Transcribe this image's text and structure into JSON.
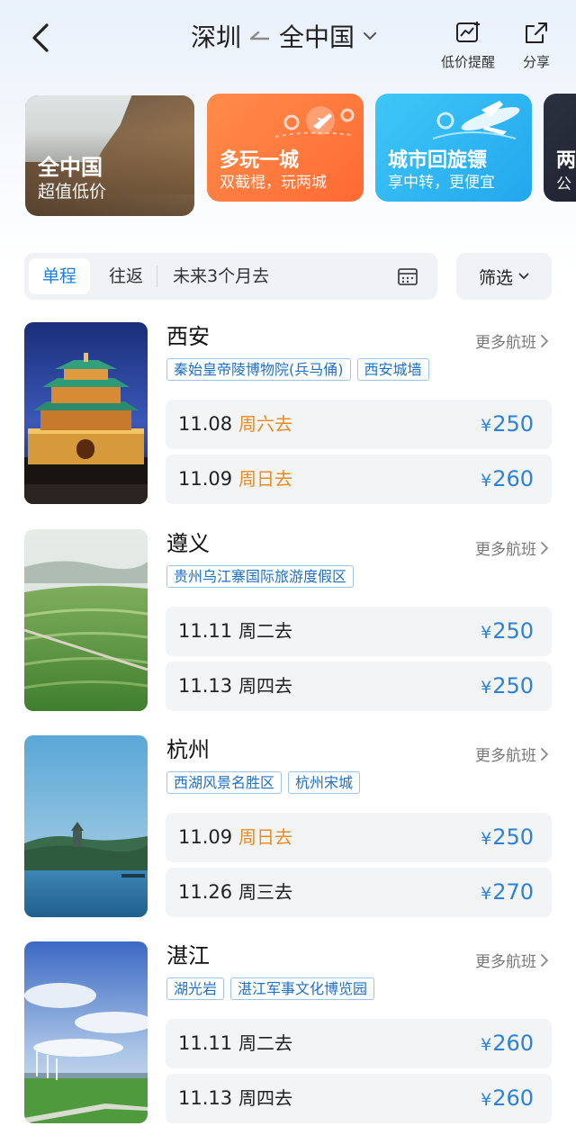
{
  "header": {
    "origin": "深圳",
    "destination": "全中国",
    "price_alert_label": "低价提醒",
    "share_label": "分享"
  },
  "banners": [
    {
      "title": "全中国",
      "subtitle": "超值低价"
    },
    {
      "title": "多玩一城",
      "subtitle": "双截棍，玩两城"
    },
    {
      "title": "城市回旋镖",
      "subtitle": "享中转，更便宜"
    },
    {
      "title": "两",
      "subtitle": "公"
    }
  ],
  "filters": {
    "one_way": "单程",
    "round_trip": "往返",
    "period": "未来3个月去",
    "filter_label": "筛选"
  },
  "more_flights_label": "更多航班",
  "destinations": [
    {
      "city": "西安",
      "tags": [
        "秦始皇帝陵博物院(兵马俑)",
        "西安城墙"
      ],
      "flights": [
        {
          "date": "11.08",
          "weekday": "周六去",
          "price": "250"
        },
        {
          "date": "11.09",
          "weekday": "周日去",
          "price": "260"
        }
      ]
    },
    {
      "city": "遵义",
      "tags": [
        "贵州乌江寨国际旅游度假区"
      ],
      "flights": [
        {
          "date": "11.11",
          "weekday": "周二去",
          "price": "250"
        },
        {
          "date": "11.13",
          "weekday": "周四去",
          "price": "250"
        }
      ]
    },
    {
      "city": "杭州",
      "tags": [
        "西湖风景名胜区",
        "杭州宋城"
      ],
      "flights": [
        {
          "date": "11.09",
          "weekday": "周日去",
          "price": "250"
        },
        {
          "date": "11.26",
          "weekday": "周三去",
          "price": "270"
        }
      ]
    },
    {
      "city": "湛江",
      "tags": [
        "湖光岩",
        "湛江军事文化博览园"
      ],
      "flights": [
        {
          "date": "11.11",
          "weekday": "周二去",
          "price": "260"
        },
        {
          "date": "11.13",
          "weekday": "周四去",
          "price": "260"
        }
      ]
    }
  ],
  "currency_symbol": "¥",
  "colors": {
    "accent": "#1f7fe0",
    "price": "#2a82d9",
    "weekend": "#ef8a1f",
    "tag_border": "#9ec3ec"
  }
}
